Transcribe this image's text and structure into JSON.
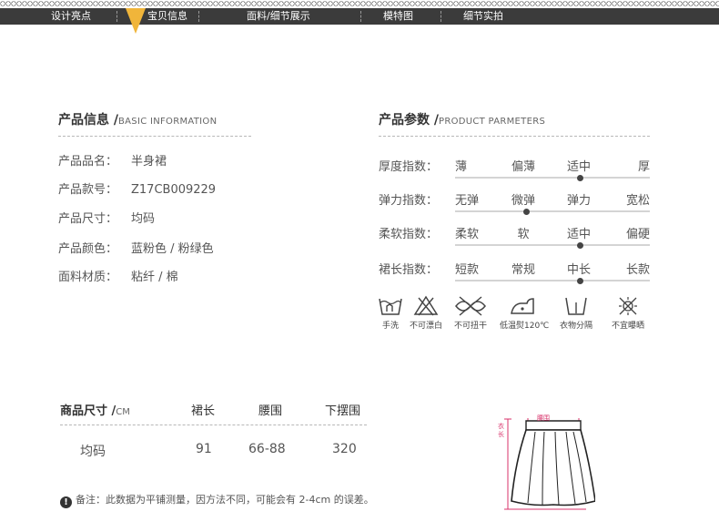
{
  "nav": {
    "items": [
      "设计亮点",
      "宝贝信息",
      "面料/细节展示",
      "模特图",
      "细节实拍"
    ],
    "accent": "#f0b53a"
  },
  "product_info": {
    "title": "产品信息 /",
    "subtitle": "BASIC INFORMATION",
    "rows": [
      {
        "label": "产品品名：",
        "value": "半身裙"
      },
      {
        "label": "产品款号：",
        "value": "Z17CB009229"
      },
      {
        "label": "产品尺寸：",
        "value": "均码"
      },
      {
        "label": "产品颜色：",
        "value": "蓝粉色 / 粉绿色"
      },
      {
        "label": "面料材质：",
        "value": "粘纤 / 棉"
      }
    ]
  },
  "parameters": {
    "title": "产品参数 /",
    "subtitle": "PRODUCT PARMETERS",
    "rows": [
      {
        "label": "厚度指数：",
        "options": [
          "薄",
          "偏薄",
          "适中",
          "厚"
        ],
        "selected_index": 2
      },
      {
        "label": "弹力指数：",
        "options": [
          "无弹",
          "微弹",
          "弹力",
          "宽松"
        ],
        "selected_index": 1
      },
      {
        "label": "柔软指数：",
        "options": [
          "柔软",
          "软",
          "适中",
          "偏硬"
        ],
        "selected_index": 2
      },
      {
        "label": "裙长指数：",
        "options": [
          "短款",
          "常规",
          "中长",
          "长款"
        ],
        "selected_index": 2
      }
    ]
  },
  "care": [
    {
      "label": "手洗",
      "icon": "hand-wash-icon"
    },
    {
      "label": "不可漂白",
      "icon": "no-bleach-icon"
    },
    {
      "label": "不可扭干",
      "icon": "no-wring-icon"
    },
    {
      "label": "低温熨120℃",
      "icon": "low-iron-icon"
    },
    {
      "label": "衣物分隔",
      "icon": "separate-wash-icon"
    },
    {
      "label": "不宜曝晒",
      "icon": "no-sun-dry-icon"
    }
  ],
  "size_table": {
    "title": "商品尺寸 /",
    "unit": "CM",
    "headers": [
      "裙长",
      "腰围",
      "下摆围"
    ],
    "rows": [
      {
        "size": "均码",
        "values": [
          "91",
          "66-88",
          "320"
        ]
      }
    ],
    "note": "备注：此数据为平铺测量，因方法不同，可能会有 2-4cm 的误差。",
    "note_icon": "!"
  },
  "diagram": {
    "waist_label": "腰围",
    "length_label": "衣长",
    "accent": "#d8336b"
  }
}
